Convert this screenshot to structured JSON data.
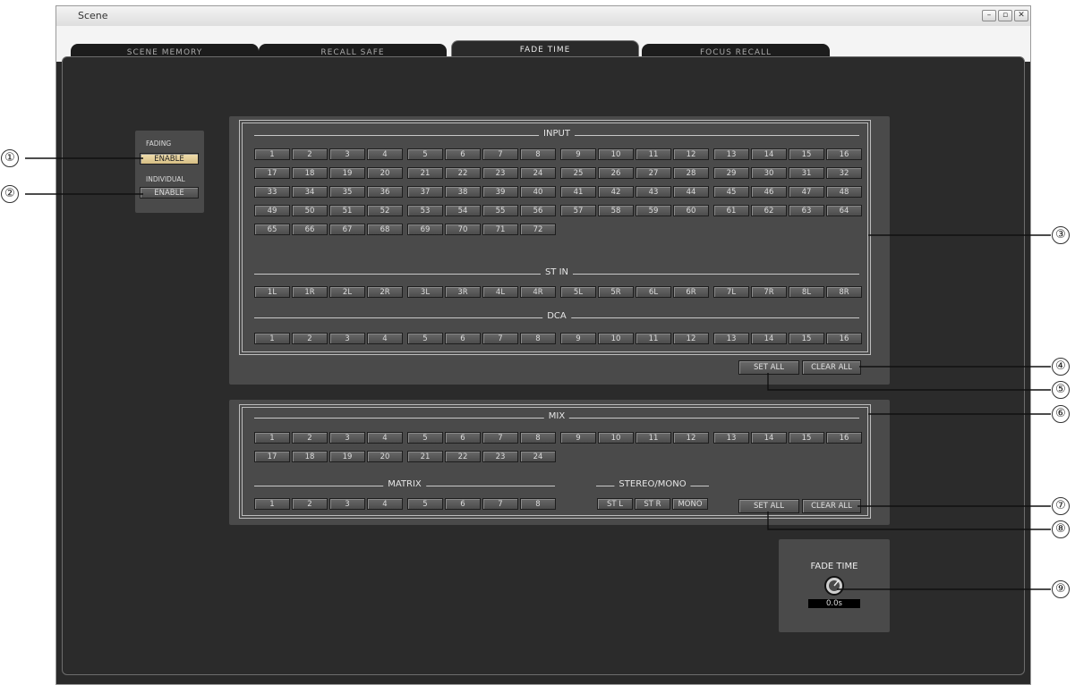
{
  "window": {
    "title": "Scene",
    "controls": [
      "minimize-icon",
      "maximize-icon",
      "close-icon"
    ]
  },
  "tabs": [
    {
      "label": "SCENE MEMORY",
      "active": false
    },
    {
      "label": "RECALL SAFE",
      "active": false
    },
    {
      "label": "FADE TIME",
      "active": true
    },
    {
      "label": "FOCUS RECALL",
      "active": false
    }
  ],
  "fading_panel": {
    "fading_label": "FADING",
    "fading_button": "ENABLE",
    "fading_enabled": true,
    "individual_label": "INDIVIDUAL",
    "individual_button": "ENABLE",
    "individual_enabled": false
  },
  "input_section": {
    "input_title": "INPUT",
    "input_channels": [
      "1",
      "2",
      "3",
      "4",
      "5",
      "6",
      "7",
      "8",
      "9",
      "10",
      "11",
      "12",
      "13",
      "14",
      "15",
      "16",
      "17",
      "18",
      "19",
      "20",
      "21",
      "22",
      "23",
      "24",
      "25",
      "26",
      "27",
      "28",
      "29",
      "30",
      "31",
      "32",
      "33",
      "34",
      "35",
      "36",
      "37",
      "38",
      "39",
      "40",
      "41",
      "42",
      "43",
      "44",
      "45",
      "46",
      "47",
      "48",
      "49",
      "50",
      "51",
      "52",
      "53",
      "54",
      "55",
      "56",
      "57",
      "58",
      "59",
      "60",
      "61",
      "62",
      "63",
      "64",
      "65",
      "66",
      "67",
      "68",
      "69",
      "70",
      "71",
      "72"
    ],
    "st_in_title": "ST IN",
    "st_in_channels": [
      "1L",
      "1R",
      "2L",
      "2R",
      "3L",
      "3R",
      "4L",
      "4R",
      "5L",
      "5R",
      "6L",
      "6R",
      "7L",
      "7R",
      "8L",
      "8R"
    ],
    "dca_title": "DCA",
    "dca_channels": [
      "1",
      "2",
      "3",
      "4",
      "5",
      "6",
      "7",
      "8",
      "9",
      "10",
      "11",
      "12",
      "13",
      "14",
      "15",
      "16"
    ],
    "set_all": "SET ALL",
    "clear_all": "CLEAR ALL"
  },
  "output_section": {
    "mix_title": "MIX",
    "mix_channels": [
      "1",
      "2",
      "3",
      "4",
      "5",
      "6",
      "7",
      "8",
      "9",
      "10",
      "11",
      "12",
      "13",
      "14",
      "15",
      "16",
      "17",
      "18",
      "19",
      "20",
      "21",
      "22",
      "23",
      "24"
    ],
    "matrix_title": "MATRIX",
    "matrix_channels": [
      "1",
      "2",
      "3",
      "4",
      "5",
      "6",
      "7",
      "8"
    ],
    "stereo_mono_title": "STEREO/MONO",
    "stereo_mono_channels": [
      "ST L",
      "ST R",
      "MONO"
    ],
    "set_all": "SET ALL",
    "clear_all": "CLEAR ALL"
  },
  "fade_time": {
    "title": "FADE TIME",
    "value": "0.0s"
  },
  "callouts": [
    "①",
    "②",
    "③",
    "④",
    "⑤",
    "⑥",
    "⑦",
    "⑧",
    "⑨"
  ]
}
